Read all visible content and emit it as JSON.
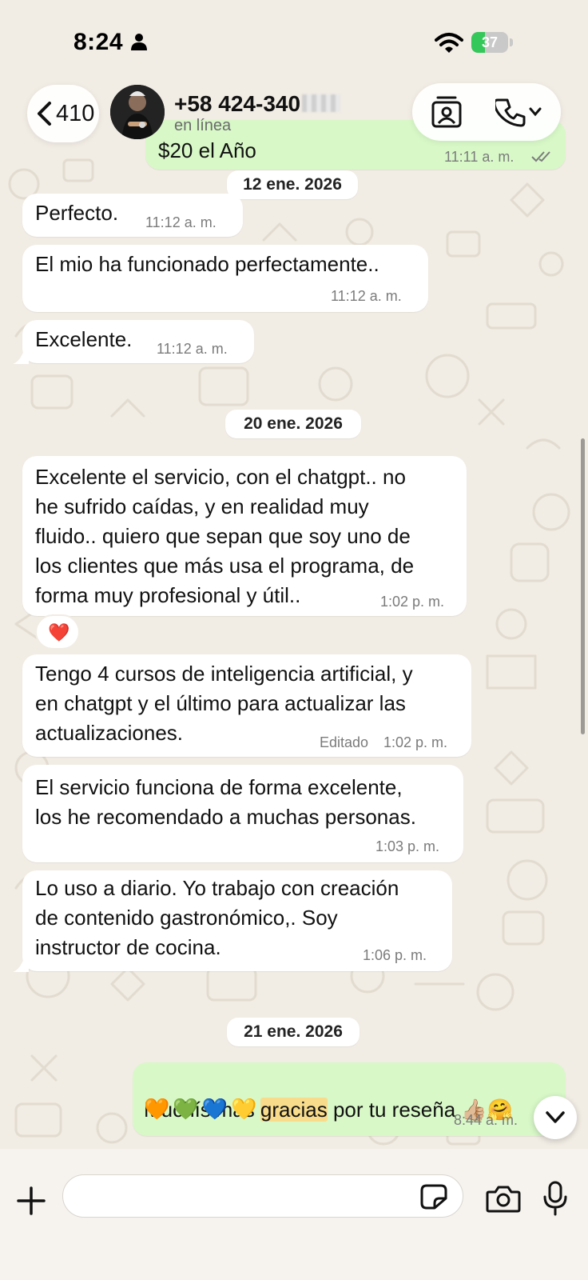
{
  "status_bar": {
    "time": "8:24",
    "battery": "37",
    "battery_level": 0.37
  },
  "header": {
    "back_count": "410",
    "contact_name_visible": "+58 424-340",
    "contact_status": "en línea"
  },
  "messages": [
    {
      "id": "m0",
      "direction": "outgoing",
      "text": "$20 el Año",
      "time": "11:11 a. m."
    },
    {
      "id": "d1",
      "type": "date",
      "text": "12 ene. 2026"
    },
    {
      "id": "m1",
      "direction": "incoming",
      "text": "Perfecto.",
      "time": "11:12 a. m."
    },
    {
      "id": "m2",
      "direction": "incoming",
      "text": "El mio ha funcionado perfectamente..",
      "time": "11:12 a. m."
    },
    {
      "id": "m3",
      "direction": "incoming",
      "text": "Excelente.",
      "time": "11:12 a. m."
    },
    {
      "id": "d2",
      "type": "date",
      "text": "20 ene. 2026"
    },
    {
      "id": "m4",
      "direction": "incoming",
      "text": "Excelente el servicio, con el chatgpt.. no\nhe sufrido caídas, y en realidad muy\nfluido.. quiero que sepan que soy uno de\nlos clientes que más usa el programa, de\nforma muy profesional y útil..",
      "time": "1:02 p. m.",
      "reaction": "❤️"
    },
    {
      "id": "m5",
      "direction": "incoming",
      "text": "Tengo 4 cursos de inteligencia artificial, y\nen chatgpt y el último para actualizar las\nactualizaciones.",
      "edited_label": "Editado",
      "time": "1:02 p. m."
    },
    {
      "id": "m6",
      "direction": "incoming",
      "text": "El servicio funciona de forma excelente,\nlos he recomendado a muchas personas.",
      "time": "1:03 p. m."
    },
    {
      "id": "m7",
      "direction": "incoming",
      "text": "Lo uso a diario. Yo trabajo con creación\nde contenido gastronómico,. Soy\ninstructor de cocina.",
      "time": "1:06 p. m."
    },
    {
      "id": "d3",
      "type": "date",
      "text": "21 ene. 2026"
    },
    {
      "id": "m8",
      "direction": "outgoing",
      "text_before": "Muchísimas ",
      "text_highlight": "gracias",
      "text_after": " por tu reseña 👍🏼🤗",
      "emojis": "🧡💚💙💛",
      "time": "8:44 a. m."
    }
  ],
  "composer": {
    "value": "",
    "placeholder": ""
  },
  "colors": {
    "background": "#f1ece4",
    "incoming_bubble": "#ffffff",
    "outgoing_bubble": "#d8f8c8",
    "battery_green": "#34c759",
    "highlight": "#f8dc8c"
  },
  "icons": [
    "person-icon",
    "wifi-icon",
    "chevron-left-icon",
    "contact-card-icon",
    "phone-icon",
    "chevron-down-icon",
    "plus-icon",
    "sticker-icon",
    "camera-icon",
    "mic-icon",
    "double-check-icon",
    "heart-icon"
  ]
}
